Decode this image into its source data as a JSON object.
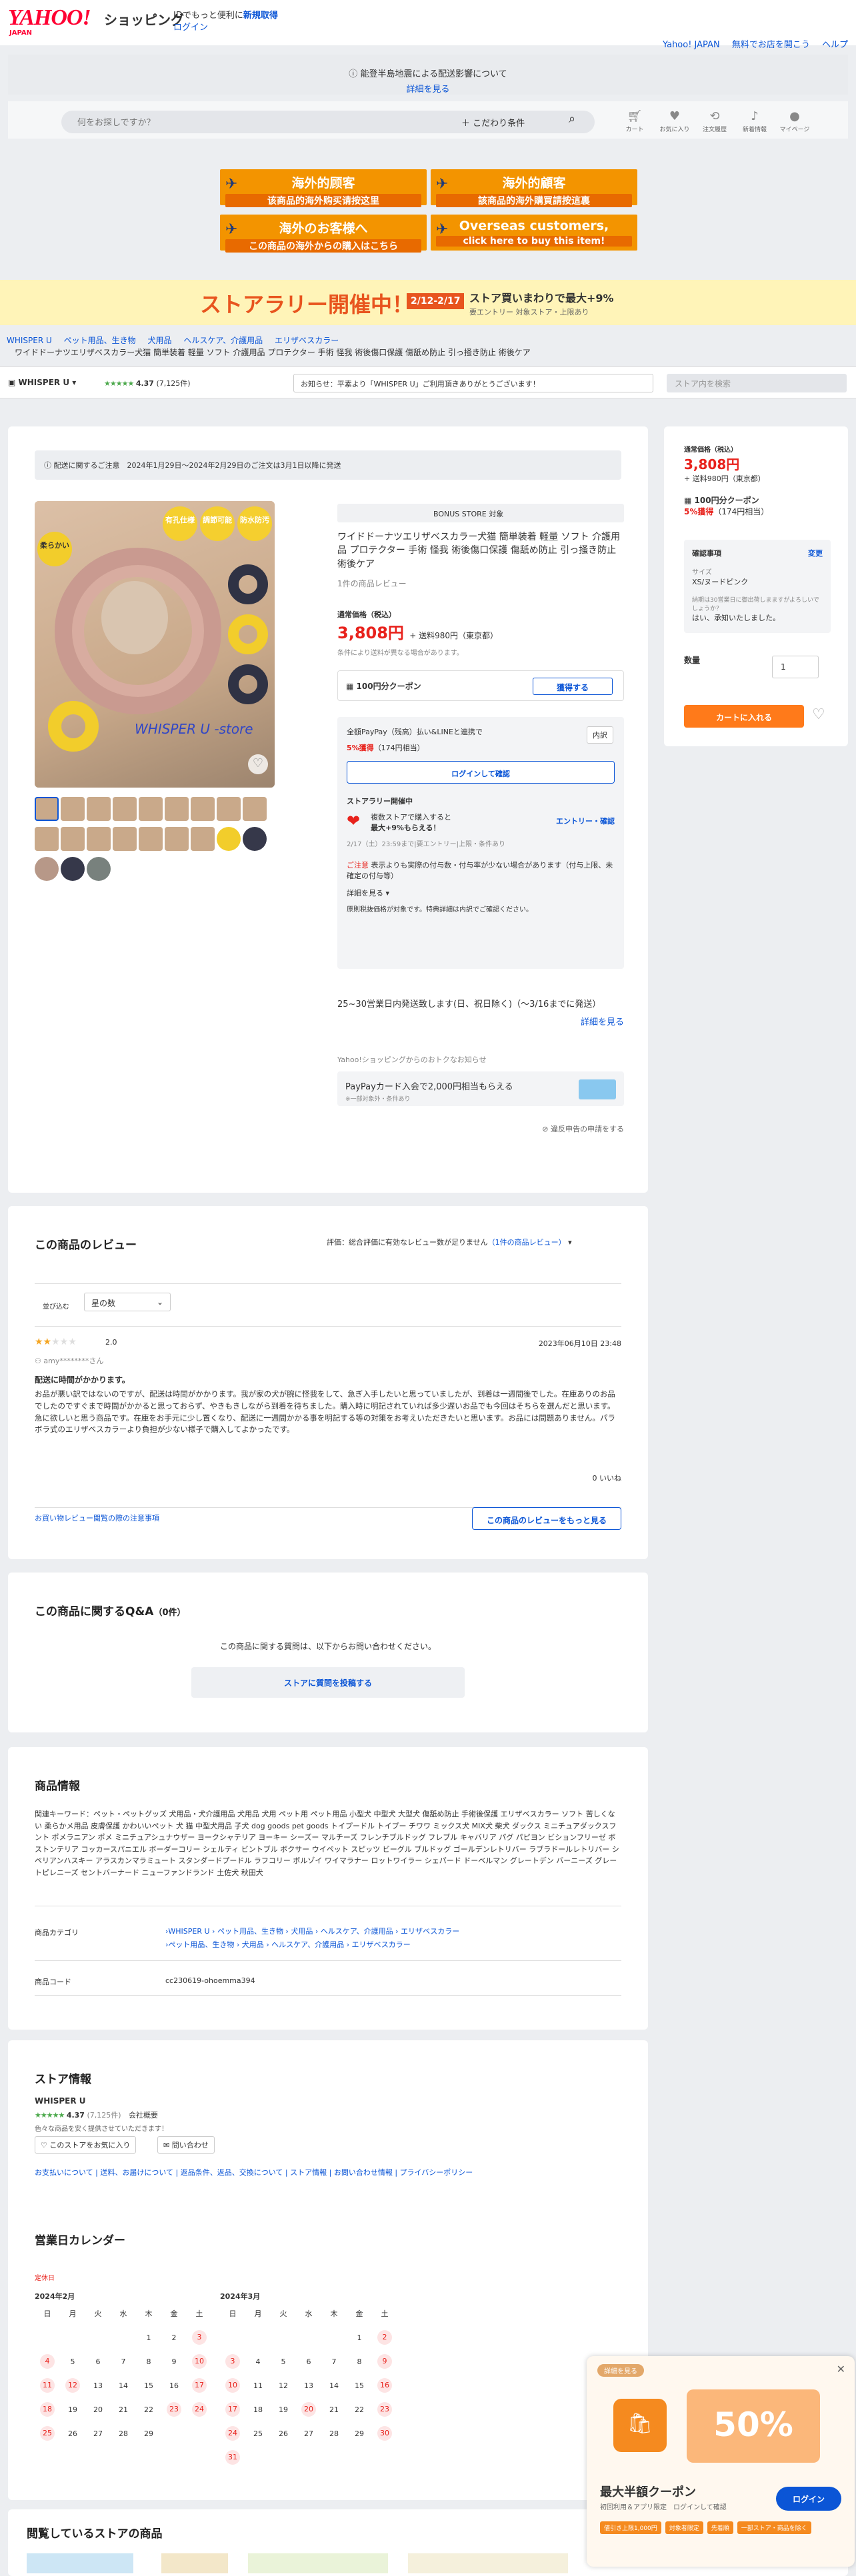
{
  "header": {
    "logo": "YAHOO!",
    "logo_sub": "JAPAN",
    "shop_title": "ショッピング",
    "tagline_pre": "IDでもっと便利に",
    "tagline_link": "新規取得",
    "login": "ログイン",
    "top_links": [
      "Yahoo! JAPAN",
      "無料でお店を開こう",
      "ヘルプ"
    ]
  },
  "notice": {
    "text": "能登半島地震による配送影響について",
    "link": "詳細を見る"
  },
  "search": {
    "placeholder": "何をお探しですか？",
    "conditions": "こだわり条件"
  },
  "icon_nav": [
    {
      "icon": "cart-icon",
      "label": "カート"
    },
    {
      "icon": "heart-icon",
      "label": "お気に入り"
    },
    {
      "icon": "history-icon",
      "label": "注文履歴"
    },
    {
      "icon": "bell-icon",
      "label": "新着情報"
    },
    {
      "icon": "user-icon",
      "label": "マイページ"
    }
  ],
  "buyee": [
    {
      "t1": "海外的顾客",
      "t2": "该商品的海外购买请按这里"
    },
    {
      "t1": "海外的顧客",
      "t2": "該商品的海外購買請按這裏"
    },
    {
      "t1": "海外のお客様へ",
      "t2": "この商品の海外からの購入はこちら"
    },
    {
      "t1": "Overseas customers,",
      "t2": "click here to buy this item!"
    }
  ],
  "rally": {
    "title": "ストアラリー開催中！",
    "date": "2/12-2/17",
    "sub": "ストア買いまわりで最大+9%",
    "sub2": "要エントリー 対象ストア・上限あり"
  },
  "breadcrumb": [
    "WHISPER U",
    "ペット用品、生き物",
    "犬用品",
    "ヘルスケア、介護用品",
    "エリザベスカラー"
  ],
  "item_title_small": "ワイドドーナツエリザベスカラー犬猫 簡単装着 軽量 ソフト 介護用品 プロテクター 手術 怪我 術後傷口保護 傷舐め防止 引っ掻き防止 術後ケア",
  "store_row": {
    "name": "WHISPER U",
    "rating": "4.37",
    "count": "(7,125件)",
    "notice": "お知らせ：平素より「WHISPER U」ご利用頂きありがとうございます！",
    "search_placeholder": "ストア内を検索"
  },
  "delivery_note": "配送に関するご注意　2024年1月29日〜2024年2月29日のご注文は3月1日以降に発送",
  "gallery": {
    "badges": [
      "有孔仕様",
      "調節可能",
      "防水防汚"
    ],
    "tag": "柔らかい",
    "watermark": "WHISPER U -store"
  },
  "product": {
    "bonus": "BONUS STORE 対象",
    "title": "ワイドドーナツエリザベスカラー犬猫 簡単装着 軽量 ソフト 介護用品 プロテクター 手術 怪我 術後傷口保護 傷舐め防止 引っ掻き防止 術後ケア",
    "reviews": "1件の商品レビュー",
    "price_label": "通常価格（税込）",
    "price": "3,808円",
    "shipping": "+ 送料980円（東京都）",
    "price_note": "条件により送料が異なる場合があります。",
    "coupon": "100円分クーポン",
    "coupon_btn": "獲得する",
    "paypay_title": "全額PayPay（残高）払い&LINEと連携で",
    "paypay_detail": "内訳",
    "paypay_pct": "5%獲得",
    "paypay_pts": "（174円相当）",
    "login_btn": "ログインして確認",
    "rally_label": "ストアラリー開催中",
    "rally_text1": "複数ストアで購入すると",
    "rally_text2": "最大+9%もらえる！",
    "rally_entry": "エントリー・確認",
    "rally_note": "2/17（土）23:59まで|要エントリー|上限・条件あり",
    "caution_head": "ご注意",
    "caution": "表示よりも実際の付与数・付与率が少ない場合があります（付与上限、未確定の付与等）",
    "more": "詳細を見る",
    "caution2": "原則税抜価格が対象です。特典詳細は内訳でご確認ください。",
    "ship_date": "25~30営業日内発送致します(日、祝日除く)（〜3/16までに発送）",
    "ship_more": "詳細を見る",
    "pp_label": "Yahoo!ショッピングからのおトクなお知らせ",
    "pp_title": "PayPayカード入会で2,000円相当もらえる",
    "pp_sub": "※一部対象外・条件あり",
    "report": "違反申告の申請をする"
  },
  "side": {
    "price_label": "通常価格（税込）",
    "price": "3,808円",
    "shipping": "+ 送料980円（東京都）",
    "coupon": "100円分クーポン",
    "points": "5%獲得",
    "points_sub": "（174円相当）",
    "confirm": "確認事項",
    "change": "変更",
    "size_label": "サイズ",
    "size_value": "XS/ヌードピンク",
    "note": "納期は30営業日に御出荷しまますがよろしいでしょうか？",
    "answer": "はい、承知いたしました。",
    "qty_label": "数量",
    "qty": "1",
    "cart_btn": "カートに入れる"
  },
  "reviews": {
    "title": "この商品のレビュー",
    "rating_note": "評価：総合評価に有効なレビュー数が足りません",
    "rating_link": "（1件の商品レビュー）",
    "sort_label": "並び込む",
    "sort_value": "星の数",
    "score": "2.0",
    "date": "2023年06月10日 23:48",
    "user": "amy********さん",
    "headline": "配送に時間がかかります。",
    "body": "お品が悪い訳ではないのですが、配送は時間がかかります。我が家の犬が腕に怪我をして、急ぎ入手したいと思っていましたが、到着は一週間後でした。在庫ありのお品でしたのですぐまで時間がかかると思っておらず、やきもきしながら到着を待ちました。購入時に明記されていれば多少遅いお品でも今回はそちらを選んだと思います。急に欲しいと思う商品です。在庫をお手元に少し置くなり、配送に一週間かかる事を明記する等の対策をお考えいただきたいと思います。お品には問題ありません。パラボラ式のエリザベスカラーより負担が少ない様子で購入してよかったです。",
    "like": "0 いいね",
    "guide": "お買い物レビュー閲覧の際の注意事項",
    "more_btn": "この商品のレビューをもっと見る"
  },
  "qa": {
    "title": "この商品に関するQ&A",
    "count": "（0件）",
    "text": "この商品に関する質問は、以下からお問い合わせください。",
    "btn": "ストアに質問を投稿する"
  },
  "pinfo": {
    "title": "商品情報",
    "keywords": "関連キーワード：ペット・ペットグッズ 犬用品・犬介護用品 犬用品 犬用 ペット用 ペット用品 小型犬 中型犬 大型犬 傷舐め防止 手術後保護 エリザベスカラー ソフト 苦しくない 柔らかメ用品 皮膚保護 かわいいペット 犬 猫 中型犬用品 子犬 dog goods pet goods トイプードル トイプー チワワ ミックス犬 MIX犬 柴犬 ダックス ミニチュアダックスフント ポメラニアン ポメ ミニチュアシュナウザー ヨークシャテリア ヨーキー シーズー マルチーズ フレンチブルドッグ フレブル キャバリア パグ パピヨン ビションフリーゼ ボストンテリア コッカースパニエル ボーダーコリー シェルティ ビントブル ボクサー ウイペット スピッツ ビーグル ブルドッグ ゴールデンレトリバー ラブラドールレトリバー シベリアンハスキー アラスカンマラミュート スタンダードプードル ラフコリー ボルゾイ ワイマラナー ロットワイラー シェパード ドーベルマン グレートデン バーニーズ グレートピレニーズ セントバーナード ニューファンドランド 土佐犬 秋田犬",
    "cat_label": "商品カテゴリ",
    "cat1": "›WHISPER U › ペット用品、生き物 › 犬用品 › ヘルスケア、介護用品 › エリザベスカラー",
    "cat2": "›ペット用品、生き物 › 犬用品 › ヘルスケア、介護用品 › エリザベスカラー",
    "code_label": "商品コード",
    "code": "cc230619-ohoemma394"
  },
  "store": {
    "title": "ストア情報",
    "name": "WHISPER U",
    "rating": "4.37",
    "count": "(7,125件)",
    "company": "会社概要",
    "desc": "色々な商品を安く提供させていただきます！",
    "fav_btn": "このストアをお気に入り",
    "contact_btn": "問い合わせ",
    "links": [
      "お支払いについて",
      "送料、お届けについて",
      "返品条件、返品、交換について",
      "ストア情報",
      "お問い合わせ情報",
      "プライバシーポリシー"
    ],
    "cal_title": "営業日カレンダー",
    "holiday": "定休日",
    "m1": "2024年2月",
    "m2": "2024年3月",
    "weekdays": [
      "日",
      "月",
      "火",
      "水",
      "木",
      "金",
      "土"
    ],
    "feb": [
      "",
      "",
      "",
      "",
      "1",
      "2",
      "3",
      "4",
      "5",
      "6",
      "7",
      "8",
      "9",
      "10",
      "11",
      "12",
      "13",
      "14",
      "15",
      "16",
      "17",
      "18",
      "19",
      "20",
      "21",
      "22",
      "23",
      "24",
      "25",
      "26",
      "27",
      "28",
      "29",
      "",
      ""
    ],
    "mar": [
      "",
      "",
      "",
      "",
      "",
      "1",
      "2",
      "3",
      "4",
      "5",
      "6",
      "7",
      "8",
      "9",
      "10",
      "11",
      "12",
      "13",
      "14",
      "15",
      "16",
      "17",
      "18",
      "19",
      "20",
      "21",
      "22",
      "23",
      "24",
      "25",
      "26",
      "27",
      "28",
      "29",
      "30",
      "31",
      "",
      "",
      "",
      "",
      "",
      ""
    ]
  },
  "viewed": {
    "title": "閲覧しているストアの商品"
  },
  "float_ad": {
    "label": "詳細を見る",
    "percent": "50%",
    "title": "最大半額クーポン",
    "sub": "初回利用＆アプリ限定",
    "sub2": "ログインして確認",
    "login": "ログイン",
    "tags": [
      "値引き上限1,000円",
      "対象者限定",
      "先着順",
      "一部ストア・商品を除く"
    ]
  }
}
